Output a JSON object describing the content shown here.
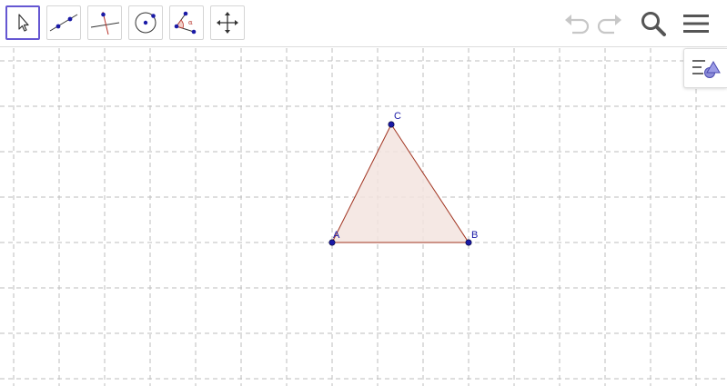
{
  "toolbar": {
    "tools": [
      {
        "icon": "move-arrow-icon",
        "selected": true
      },
      {
        "icon": "line-icon",
        "selected": false
      },
      {
        "icon": "perpendicular-line-icon",
        "selected": false
      },
      {
        "icon": "circle-center-point-icon",
        "selected": false
      },
      {
        "icon": "angle-icon",
        "selected": false
      },
      {
        "icon": "move-graphics-view-icon",
        "selected": false
      }
    ],
    "right_icons": [
      "undo-icon",
      "redo-icon",
      "search-icon",
      "menu-icon"
    ]
  },
  "graphics": {
    "grid": true,
    "grid_style": "dashed",
    "points": [
      {
        "name": "A",
        "x": 0,
        "y": 0
      },
      {
        "name": "B",
        "x": 3,
        "y": 0
      },
      {
        "name": "C",
        "x": 1.3,
        "y": 2.6
      }
    ],
    "polygon": {
      "vertices": [
        "A",
        "B",
        "C"
      ],
      "fill": "#f3e4df",
      "stroke": "#a0321e"
    },
    "point_color": "#1a1aa6"
  },
  "algebra_toggle_icon": "algebra-view-icon",
  "colors": {
    "accent": "#6557d2",
    "grid": "#bdbdbd",
    "icon": "#555555"
  }
}
